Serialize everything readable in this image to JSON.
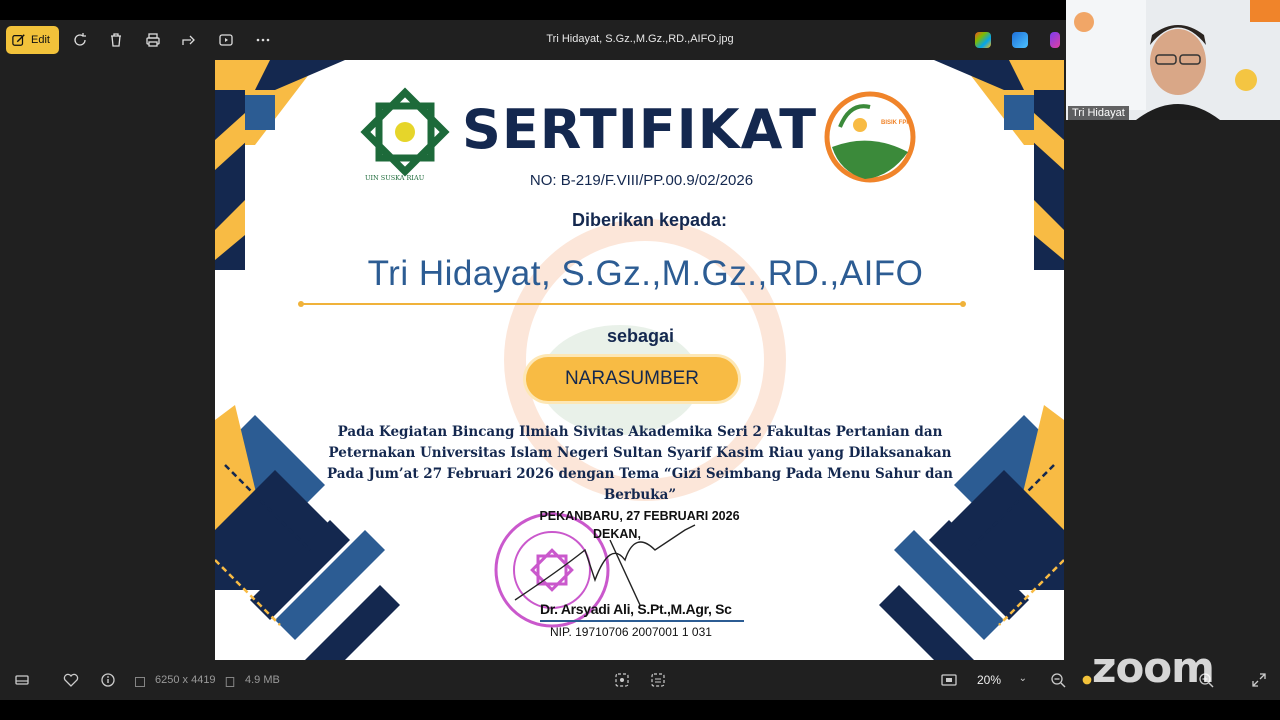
{
  "viewer": {
    "edit_label": "Edit",
    "file_title": "Tri Hidayat, S.Gz.,M.Gz.,RD.,AIFO.jpg",
    "image_dimensions": "6250 x 4419",
    "file_size": "4.9 MB",
    "zoom_level": "20%"
  },
  "certificate": {
    "title": "SERTIFIKAT",
    "number": "NO: B-219/F.VIII/PP.00.9/02/2026",
    "given_to": "Diberikan kepada:",
    "recipient": "Tri Hidayat, S.Gz.,M.Gz.,RD.,AIFO",
    "as_label": "sebagai",
    "role": "NARASUMBER",
    "body": "Pada Kegiatan Bincang Ilmiah Sivitas Akademika Seri 2 Fakultas Pertanian dan Peternakan Universitas Islam Negeri Sultan Syarif Kasim Riau yang Dilaksanakan Pada Jum’at 27 Februari 2026 dengan Tema “Gizi Seimbang Pada Menu Sahur dan Berbuka”",
    "place_date": "PEKANBARU, 27 FEBRUARI 2026",
    "position": "DEKAN,",
    "signer": "Dr. Arsyadi Ali, S.Pt.,M.Agr, Sc",
    "nip": "NIP. 19710706 2007001 1 031",
    "uin_caption": "UIN SUSKA RIAU",
    "bisik_logo_text": "BISIK FPP"
  },
  "meeting": {
    "participant_name": "Tri Hidayat",
    "watermark": "zoom"
  },
  "colors": {
    "navy": "#14284f",
    "gold": "#f8bb44",
    "name_blue": "#2c5c93",
    "edit_button": "#f2c23a"
  }
}
